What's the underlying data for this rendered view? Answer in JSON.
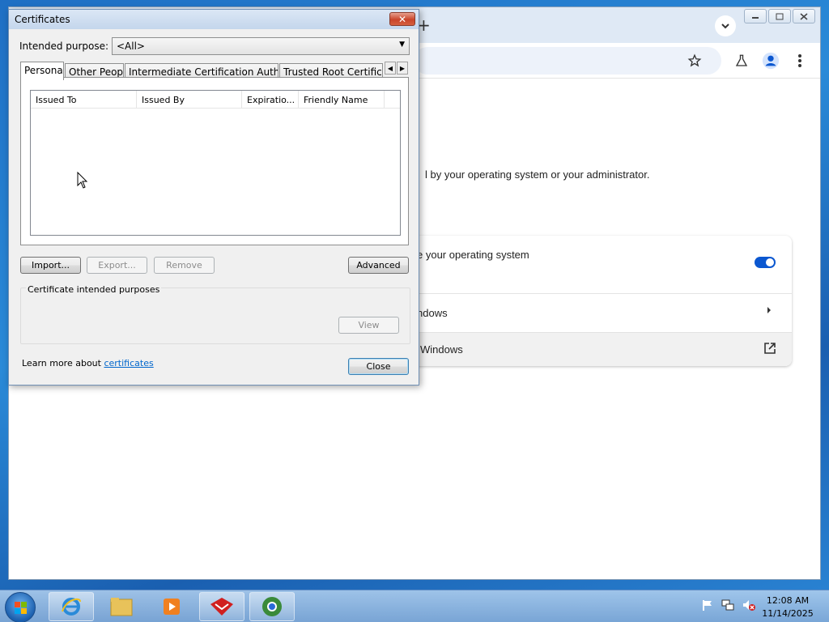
{
  "chrome": {
    "new_tab_symbol": "+",
    "settings_desc": "l by your operating system or your administrator.",
    "card_rows": [
      {
        "label": "e your operating system"
      },
      {
        "label": "ndows"
      },
      {
        "label": "Windows"
      }
    ],
    "toggle_on": true
  },
  "dialog": {
    "title": "Certificates",
    "close_symbol": "✕",
    "intended_purpose_label": "Intended purpose:",
    "intended_purpose_value": "<All>",
    "tabs": [
      "Personal",
      "Other People",
      "Intermediate Certification Authorities",
      "Trusted Root Certification Authorities"
    ],
    "active_tab": "Personal",
    "columns": [
      "Issued To",
      "Issued By",
      "Expiratio...",
      "Friendly Name"
    ],
    "rows": [],
    "buttons": {
      "import": "Import...",
      "export": "Export...",
      "remove": "Remove",
      "advanced": "Advanced",
      "view": "View",
      "close": "Close"
    },
    "group_title": "Certificate intended purposes",
    "learn_prefix": "Learn more about ",
    "learn_link": "certificates"
  },
  "taskbar": {
    "time": "12:08 AM",
    "date": "11/14/2025"
  },
  "colors": {
    "accent": "#0b57d0",
    "link": "#0066cc",
    "close_button": "#c9452a"
  }
}
